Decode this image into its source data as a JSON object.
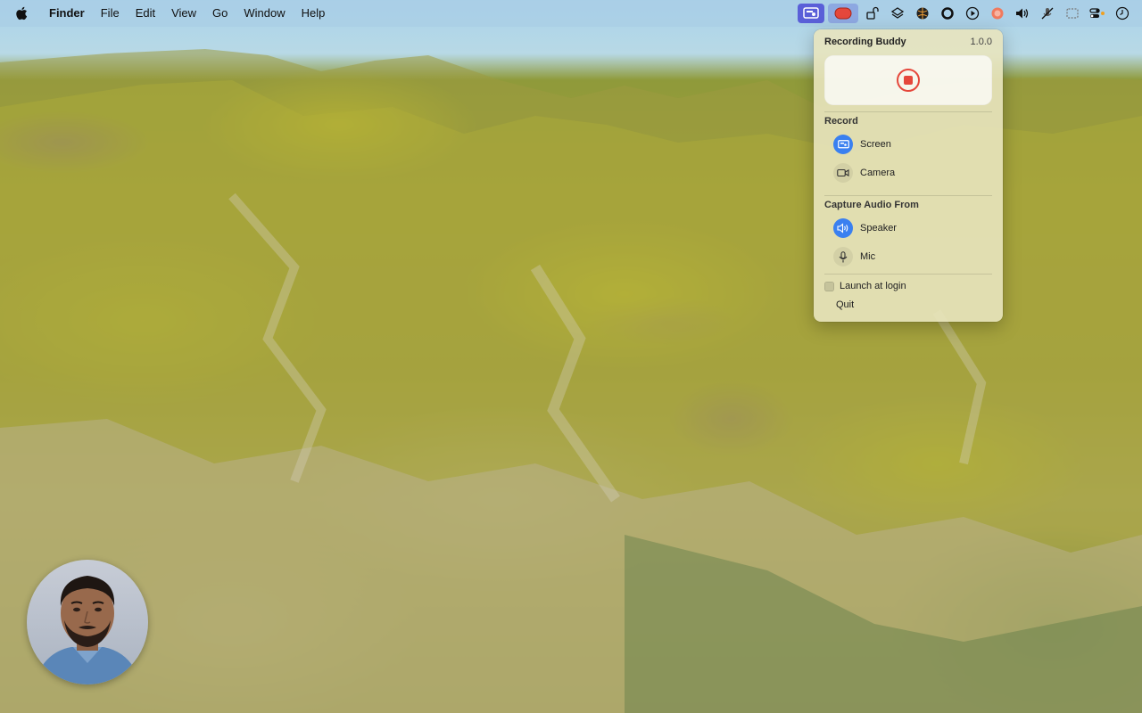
{
  "menubar": {
    "app_name": "Finder",
    "menus": [
      "File",
      "Edit",
      "View",
      "Go",
      "Window",
      "Help"
    ],
    "status_icons": [
      "screen-record-icon",
      "recording-indicator-icon",
      "lock-rotate-icon",
      "layers-icon",
      "basketball-icon",
      "circle-icon",
      "play-icon",
      "record-dot-icon",
      "volume-icon",
      "mic-muted-icon",
      "sidebar-icon",
      "control-center-icon",
      "clock-icon"
    ]
  },
  "popover": {
    "title": "Recording Buddy",
    "version": "1.0.0",
    "record_section": {
      "label": "Record",
      "items": [
        {
          "label": "Screen",
          "icon": "screen-icon",
          "active": true
        },
        {
          "label": "Camera",
          "icon": "camera-icon",
          "active": false
        }
      ]
    },
    "audio_section": {
      "label": "Capture Audio From",
      "items": [
        {
          "label": "Speaker",
          "icon": "speaker-icon",
          "active": true
        },
        {
          "label": "Mic",
          "icon": "mic-icon",
          "active": false
        }
      ]
    },
    "launch_at_login": {
      "label": "Launch at login",
      "checked": false
    },
    "quit_label": "Quit"
  },
  "colors": {
    "accent_blue": "#3a80f0",
    "record_red": "#e5473b",
    "menubar_active": "#5a5fd8"
  }
}
